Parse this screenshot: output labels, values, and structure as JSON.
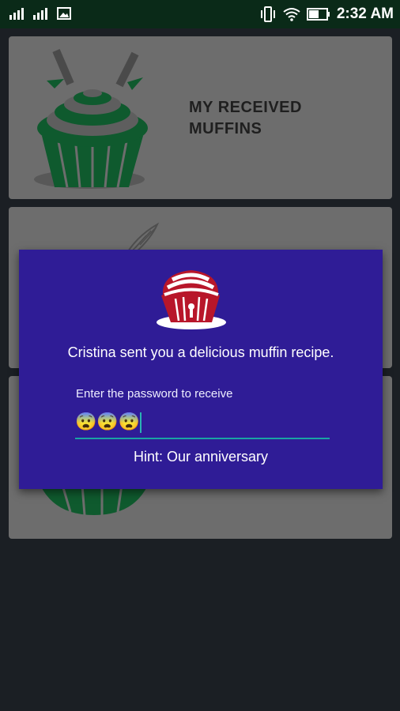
{
  "status_bar": {
    "time": "2:32 AM",
    "icons": [
      "signal-icon",
      "signal-icon-2",
      "image-icon",
      "vibrate-icon",
      "wifi-icon",
      "battery-icon"
    ]
  },
  "cards": [
    {
      "title": "MY RECEIVED MUFFINS"
    },
    {
      "title": ""
    },
    {
      "title": ""
    }
  ],
  "dialog": {
    "message": "Cristina sent you a delicious muffin recipe.",
    "prompt": "Enter the password to receive",
    "password_value": "😨😨😨",
    "hint": "Hint: Our anniversary"
  },
  "colors": {
    "dialog_bg": "#2f1c96",
    "accent": "#1aa3a3",
    "muffin_red": "#b8162a"
  }
}
